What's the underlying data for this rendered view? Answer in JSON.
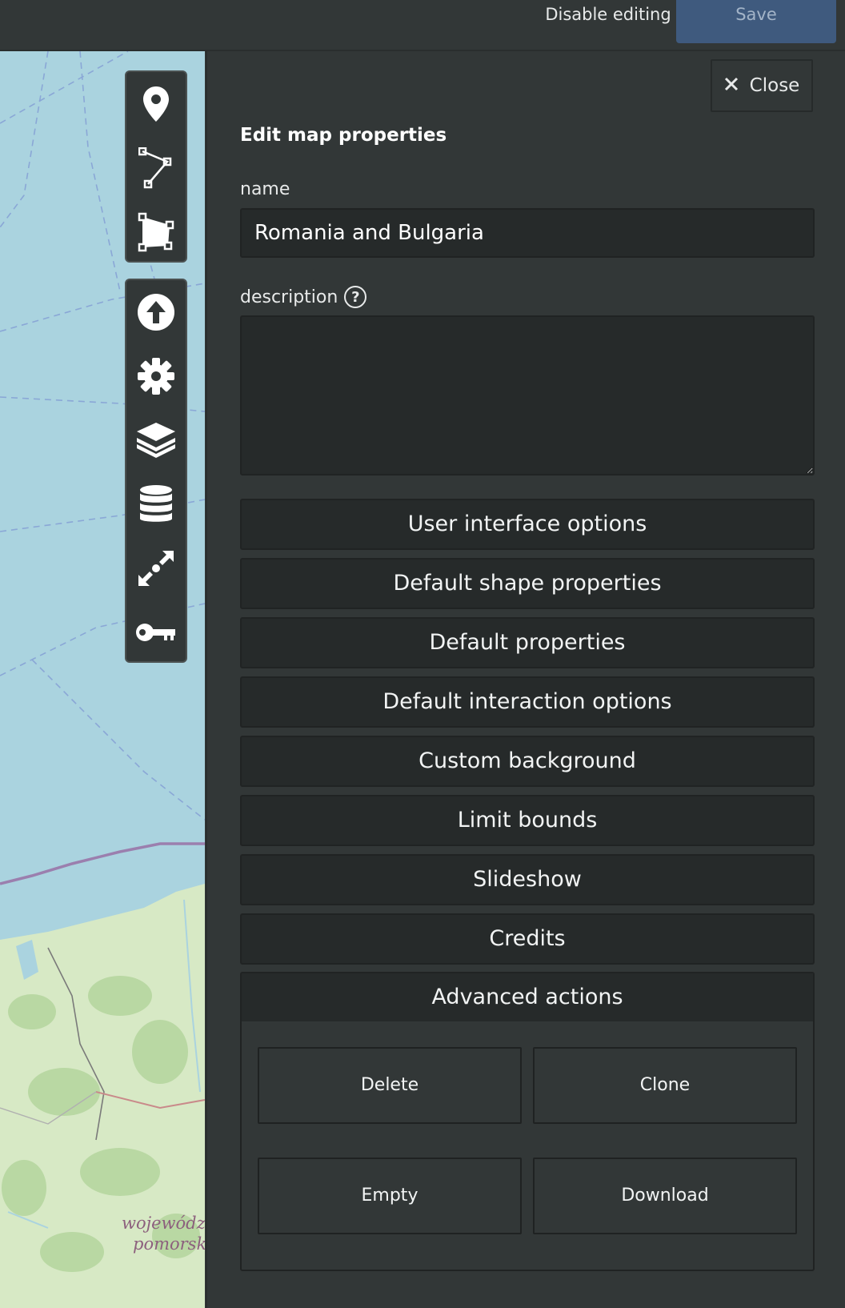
{
  "topbar": {
    "disable_editing_label": "Disable editing",
    "save_label": "Save"
  },
  "map": {
    "labels": [
      "województwo",
      "pomorskie"
    ]
  },
  "toolbar_draw": {
    "items": [
      {
        "icon": "marker-icon"
      },
      {
        "icon": "polyline-icon"
      },
      {
        "icon": "polygon-icon"
      }
    ]
  },
  "toolbar_settings": {
    "items": [
      {
        "icon": "upload-icon"
      },
      {
        "icon": "gear-icon"
      },
      {
        "icon": "layers-icon"
      },
      {
        "icon": "database-icon"
      },
      {
        "icon": "center-icon"
      },
      {
        "icon": "key-icon"
      }
    ]
  },
  "panel": {
    "close_label": "Close",
    "title": "Edit map properties",
    "name_label": "name",
    "name_value": "Romania and Bulgaria",
    "description_label": "description",
    "help_glyph": "?",
    "sections": [
      "User interface options",
      "Default shape properties",
      "Default properties",
      "Default interaction options",
      "Custom background",
      "Limit bounds",
      "Slideshow",
      "Credits"
    ],
    "advanced": {
      "label": "Advanced actions",
      "buttons": [
        "Delete",
        "Clone",
        "Empty",
        "Download"
      ]
    }
  },
  "colors": {
    "panel_bg": "#323737",
    "field_bg": "#262a2a",
    "save_bg": "#3f5a7e",
    "sea": "#aad3df",
    "land": "#d7e9c5"
  }
}
